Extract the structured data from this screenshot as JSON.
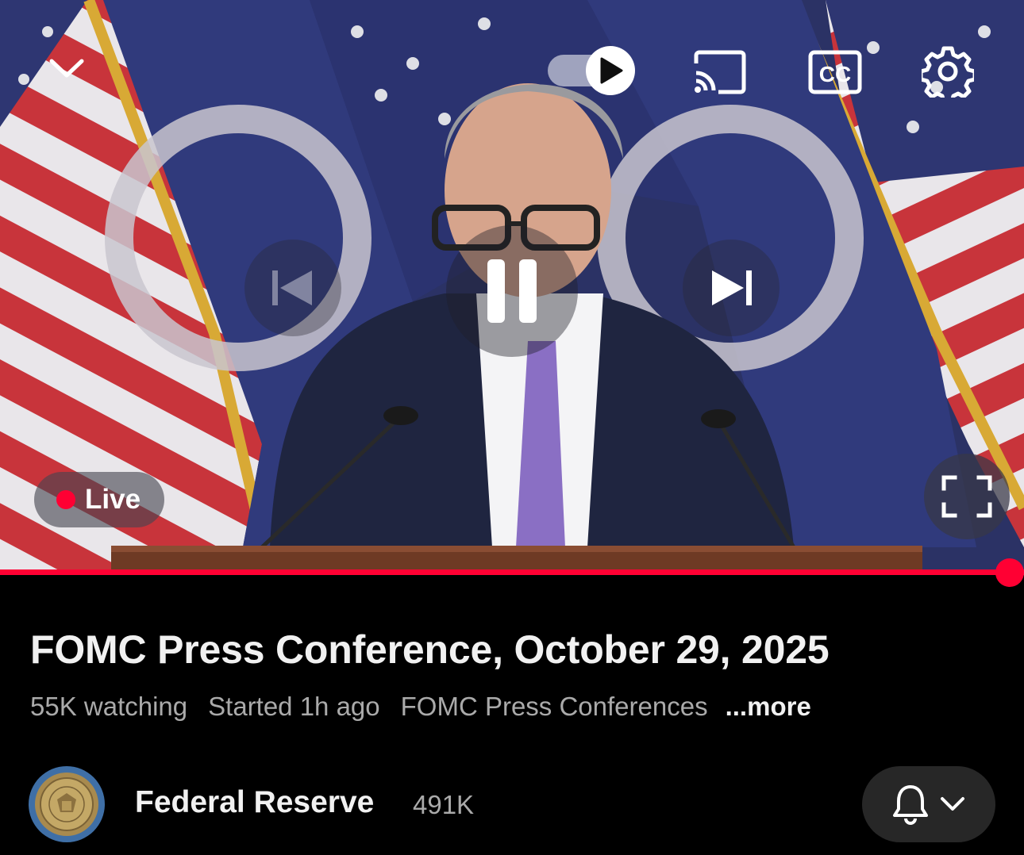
{
  "player": {
    "live_label": "Live",
    "progress_fraction": 1.0,
    "icons": {
      "collapse": "chevron-down-icon",
      "autoplay": "play-icon",
      "cast": "cast-icon",
      "captions": "cc-icon",
      "settings": "gear-icon",
      "previous": "skip-previous-icon",
      "pause": "pause-icon",
      "next": "skip-next-icon",
      "fullscreen": "fullscreen-icon"
    },
    "captions_label": "CC"
  },
  "video": {
    "title": "FOMC Press Conference, October 29, 2025",
    "watching": "55K watching",
    "started": "Started 1h ago",
    "playlist": "FOMC Press Conferences",
    "more_label": "...more"
  },
  "channel": {
    "name": "Federal Reserve",
    "subscribers": "491K",
    "bell_icon": "bell-icon",
    "dropdown_icon": "chevron-down-icon"
  },
  "colors": {
    "accent_red": "#ff0033",
    "background": "#000000",
    "secondary_text": "#aaaaaa"
  }
}
